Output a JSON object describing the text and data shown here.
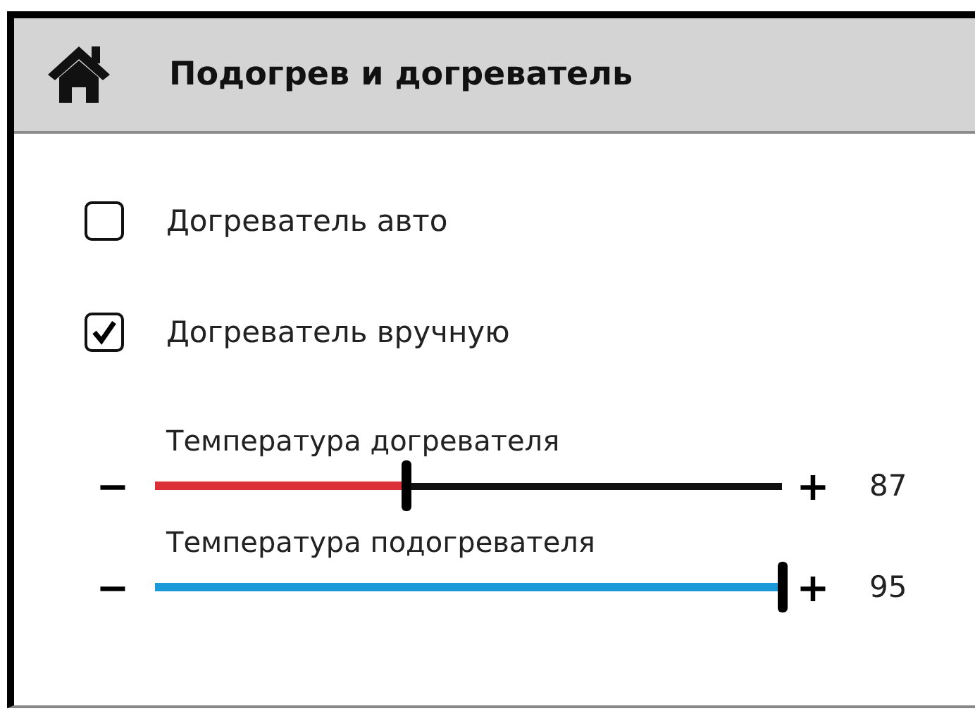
{
  "header": {
    "title": "Подогрев и догреватель"
  },
  "checkboxes": [
    {
      "label": "Догреватель авто",
      "checked": false
    },
    {
      "label": "Догреватель вручную",
      "checked": true
    }
  ],
  "sliders": [
    {
      "label": "Температура догревателя",
      "minus": "−",
      "plus": "+",
      "value": "87",
      "level": 0.4,
      "color": "#dc3038"
    },
    {
      "label": "Температура подогревателя",
      "minus": "−",
      "plus": "+",
      "value": "95",
      "level": 1,
      "color": "#1a9ad8"
    }
  ]
}
